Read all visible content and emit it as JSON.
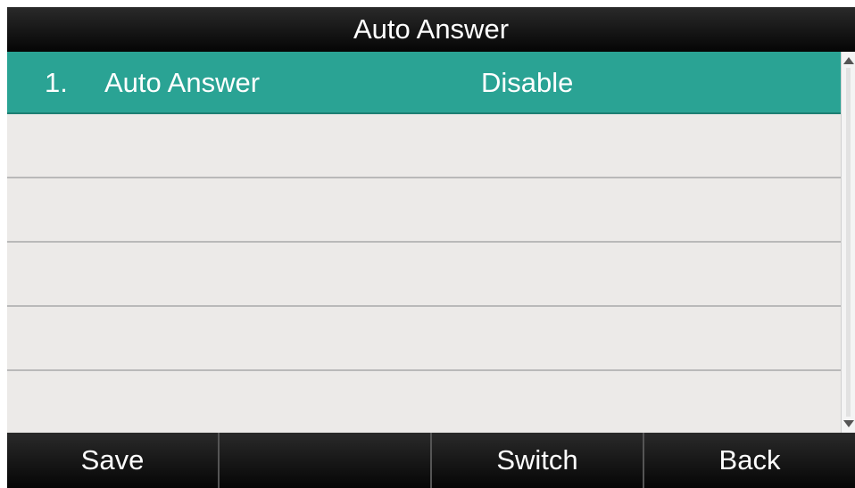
{
  "title": "Auto Answer",
  "list": {
    "items": [
      {
        "number": "1.",
        "label": "Auto Answer",
        "value": "Disable",
        "selected": true
      }
    ]
  },
  "softkeys": [
    "Save",
    "",
    "Switch",
    "Back"
  ],
  "colors": {
    "selected_row": "#2aa394",
    "title_bar": "#101010",
    "list_background": "#eceae8"
  }
}
